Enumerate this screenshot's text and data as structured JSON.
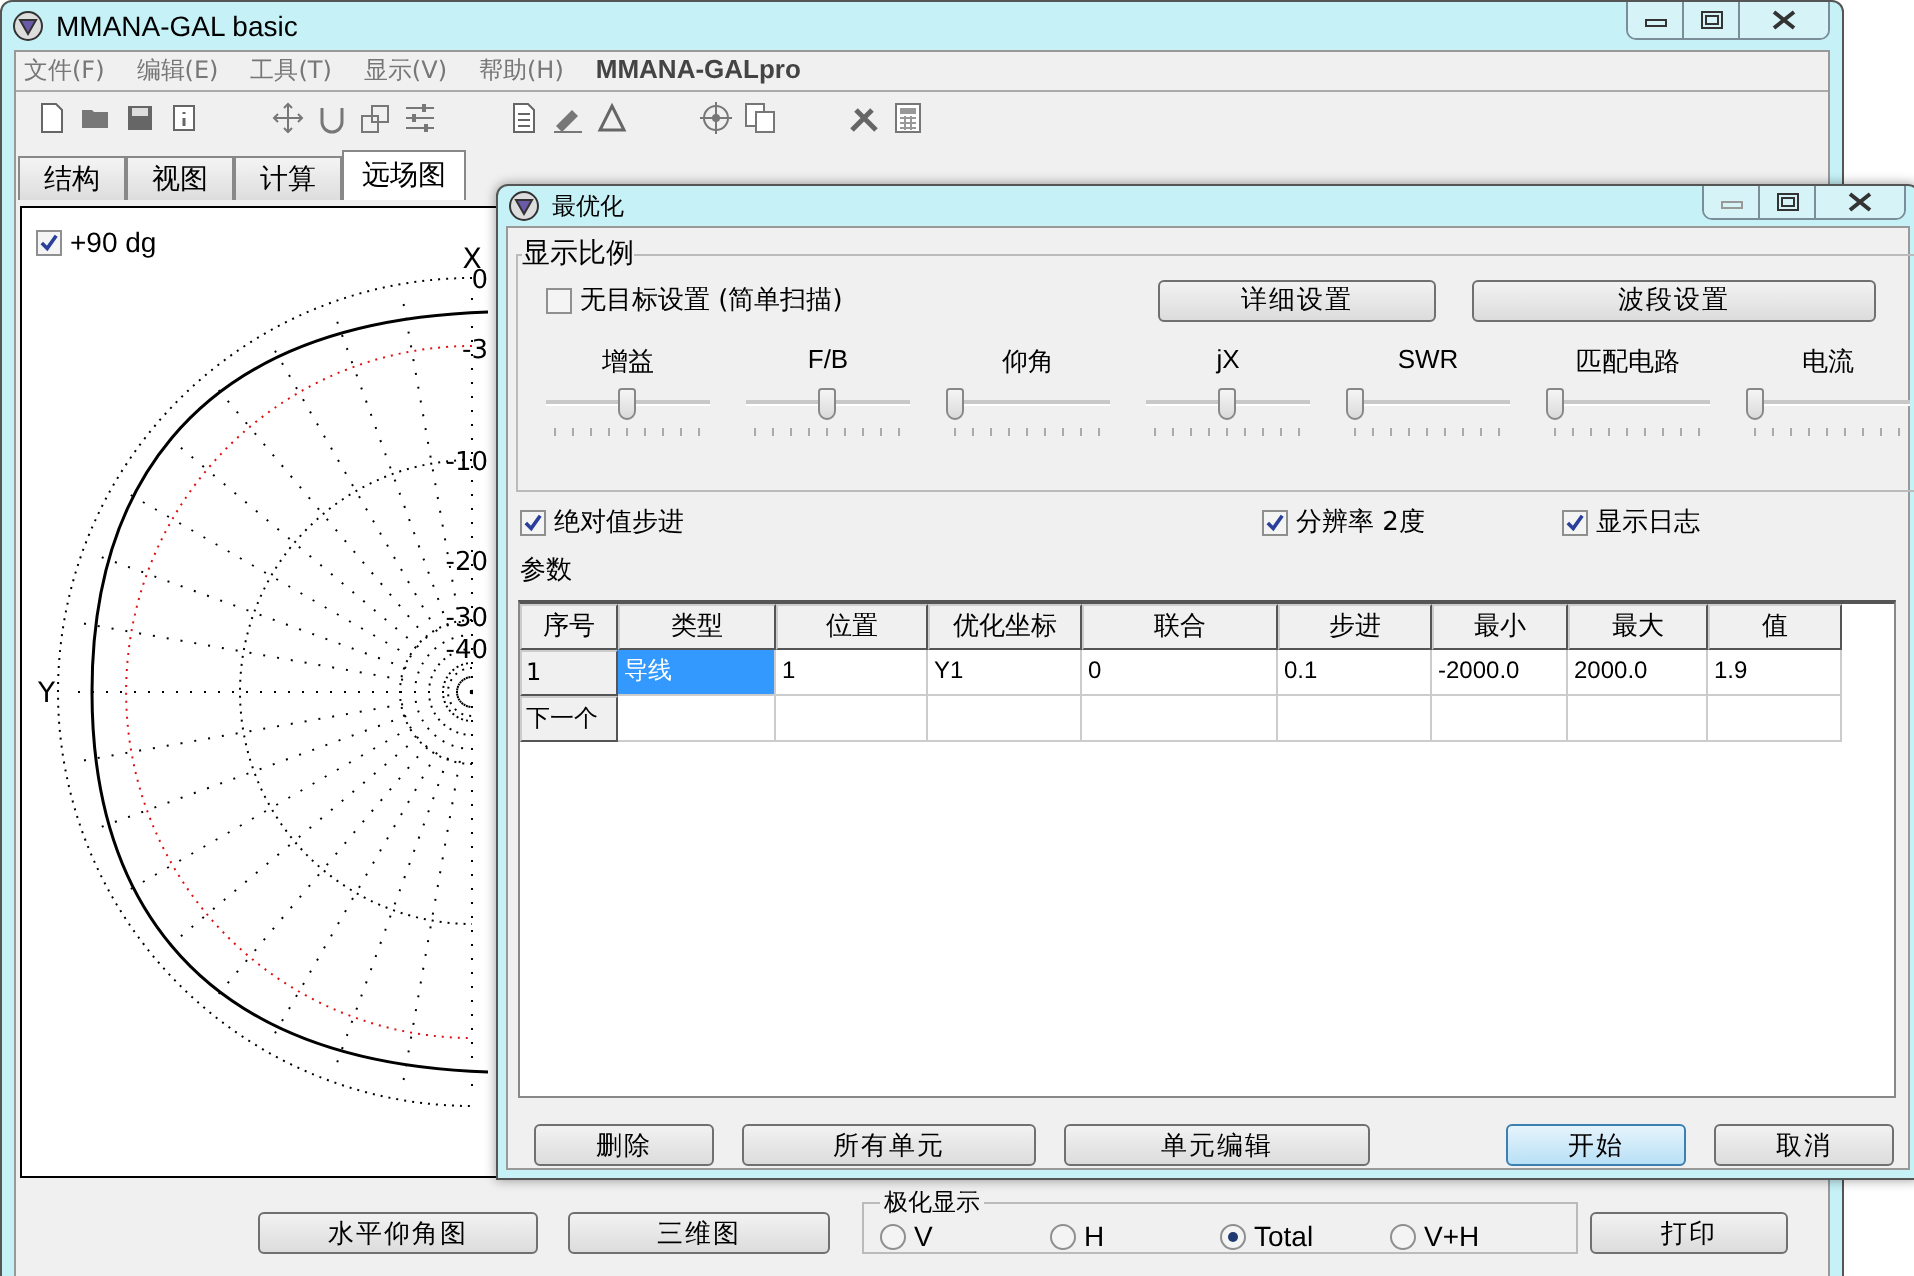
{
  "main_window": {
    "title": "MMANA-GAL basic",
    "menu": [
      "文件(F)",
      "编辑(E)",
      "工具(T)",
      "显示(V)",
      "帮助(H)",
      "MMANA-GALpro"
    ],
    "tabs": [
      {
        "label": "结构",
        "selected": false
      },
      {
        "label": "视图",
        "selected": false
      },
      {
        "label": "计算",
        "selected": false
      },
      {
        "label": "远场图",
        "selected": true
      }
    ],
    "plot": {
      "elevation_checkbox": {
        "label": "+90 dg",
        "checked": true
      },
      "x_axis_label": "X",
      "y_axis_label": "Y",
      "ring_labels": [
        "0",
        "-3",
        "-10",
        "-20",
        "-30",
        "-40"
      ]
    },
    "buttons": [
      "水平仰角图",
      "三维图"
    ],
    "polarization": {
      "title": "极化显示",
      "options": [
        {
          "label": "V",
          "selected": false
        },
        {
          "label": "H",
          "selected": false
        },
        {
          "label": "Total",
          "selected": true
        },
        {
          "label": "V+H",
          "selected": false
        }
      ]
    },
    "print_button": "打印"
  },
  "dialog": {
    "title": "最优化",
    "scale_group": {
      "title": "显示比例",
      "no_target": {
        "label": "无目标设置 (简单扫描)",
        "checked": false
      },
      "buttons": [
        "详细设置",
        "波段设置"
      ],
      "sliders": [
        {
          "label": "增益",
          "level": 0.5
        },
        {
          "label": "F/B",
          "level": 0.5
        },
        {
          "label": "仰角",
          "level": 0
        },
        {
          "label": "jX",
          "level": 0.5
        },
        {
          "label": "SWR",
          "level": 0
        },
        {
          "label": "匹配电路",
          "level": 0
        },
        {
          "label": "电流",
          "level": 0
        }
      ]
    },
    "options": [
      {
        "label": "绝对值步进",
        "checked": true
      },
      {
        "label": "分辨率 2度",
        "checked": true
      },
      {
        "label": "显示日志",
        "checked": true
      }
    ],
    "params_label": "参数",
    "table": {
      "columns": [
        "序号",
        "类型",
        "位置",
        "优化坐标",
        "联合",
        "步进",
        "最小",
        "最大",
        "值"
      ],
      "rows": [
        {
          "cells": [
            {
              "text": "1",
              "selected": false
            },
            {
              "text": "导线",
              "selected": true
            },
            {
              "text": "1",
              "selected": false
            },
            {
              "text": "Y1",
              "selected": false
            },
            {
              "text": "0",
              "selected": false
            },
            {
              "text": "0.1",
              "selected": false
            },
            {
              "text": "-2000.0",
              "selected": false
            },
            {
              "text": "2000.0",
              "selected": false
            },
            {
              "text": "1.9",
              "selected": false
            }
          ]
        },
        {
          "cells": [
            {
              "text": "下一个",
              "selected": false
            }
          ]
        }
      ]
    },
    "buttons": [
      {
        "label": "删除",
        "default": false
      },
      {
        "label": "所有单元",
        "default": false
      },
      {
        "label": "单元编辑",
        "default": false
      },
      {
        "label": "开始",
        "default": true
      },
      {
        "label": "取消",
        "default": false
      }
    ]
  }
}
